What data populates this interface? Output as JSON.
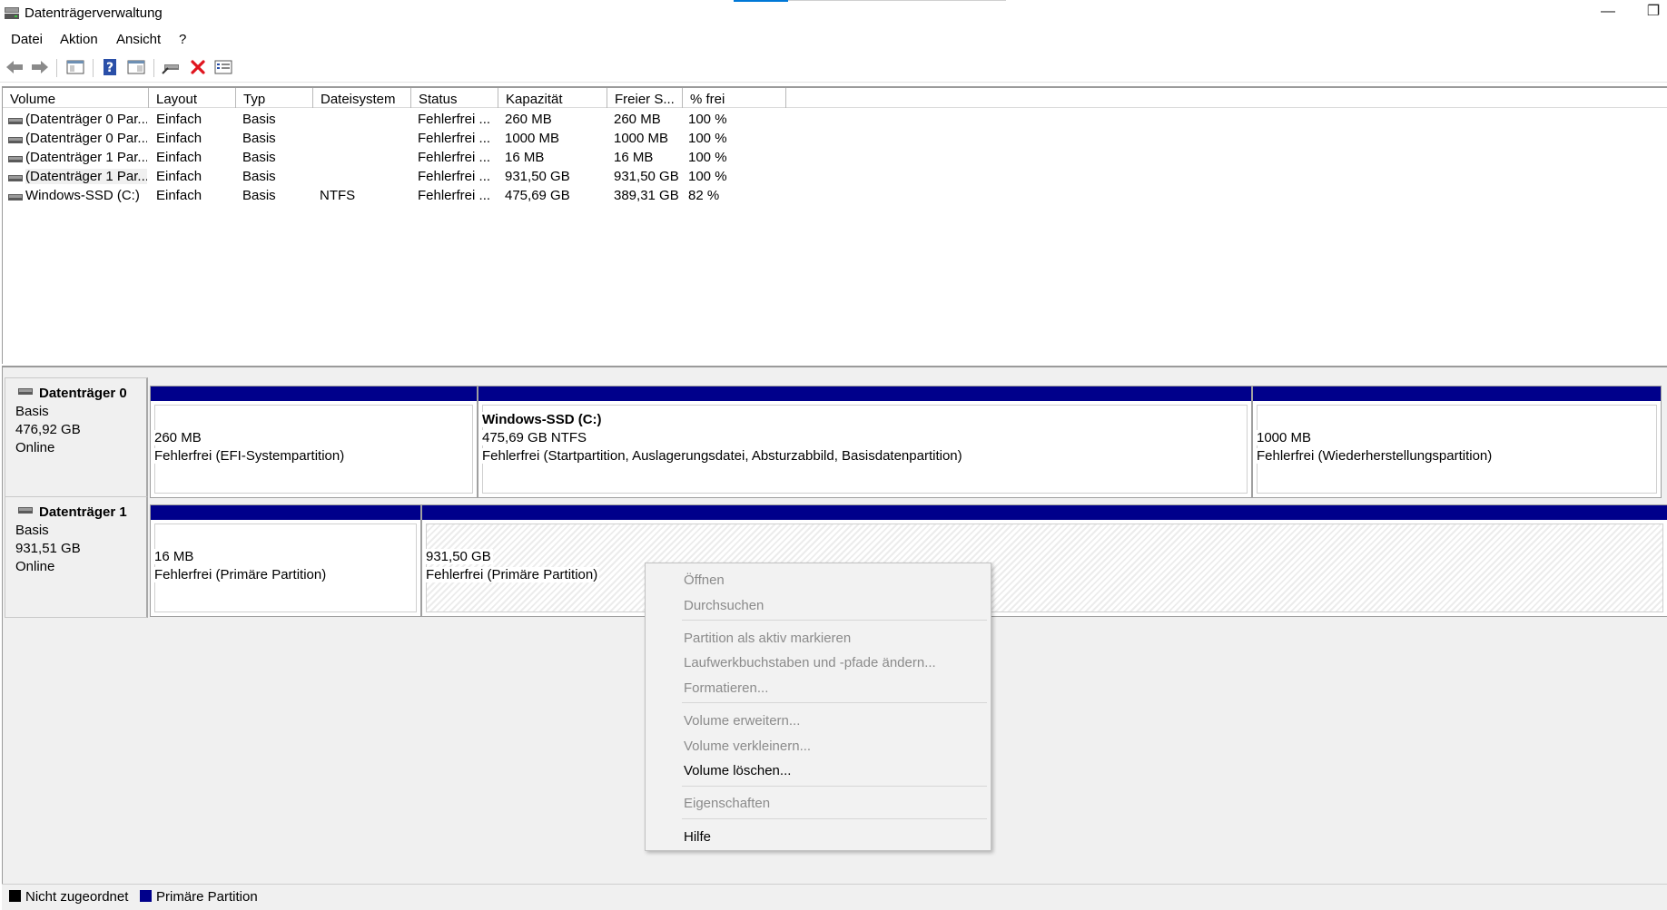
{
  "window": {
    "title": "Datenträgerverwaltung",
    "minimize_glyph": "—",
    "restore_glyph": "❐"
  },
  "menu": [
    "Datei",
    "Aktion",
    "Ansicht",
    "?"
  ],
  "toolbar": {
    "icons": [
      "back-arrow-icon",
      "forward-arrow-icon",
      "console-tree-icon",
      "help-icon",
      "show-pane-icon",
      "connect-disk-icon",
      "delete-icon",
      "properties-icon"
    ]
  },
  "volume_list": {
    "columns": [
      "Volume",
      "Layout",
      "Typ",
      "Dateisystem",
      "Status",
      "Kapazität",
      "Freier S...",
      "% frei"
    ],
    "rows": [
      [
        "(Datenträger 0 Par...",
        "Einfach",
        "Basis",
        "",
        "Fehlerfrei ...",
        "260 MB",
        "260 MB",
        "100 %"
      ],
      [
        "(Datenträger 0 Par...",
        "Einfach",
        "Basis",
        "",
        "Fehlerfrei ...",
        "1000 MB",
        "1000 MB",
        "100 %"
      ],
      [
        "(Datenträger 1 Par...",
        "Einfach",
        "Basis",
        "",
        "Fehlerfrei ...",
        "16 MB",
        "16 MB",
        "100 %"
      ],
      [
        "(Datenträger 1 Par...",
        "Einfach",
        "Basis",
        "",
        "Fehlerfrei ...",
        "931,50 GB",
        "931,50 GB",
        "100 %"
      ],
      [
        "Windows-SSD (C:)",
        "Einfach",
        "Basis",
        "NTFS",
        "Fehlerfrei ...",
        "475,69 GB",
        "389,31 GB",
        "82 %"
      ]
    ]
  },
  "disks": [
    {
      "name": "Datenträger 0",
      "type": "Basis",
      "size": "476,92 GB",
      "state": "Online",
      "partitions": [
        {
          "title": "",
          "size": "260 MB",
          "status": "Fehlerfrei (EFI-Systempartition)"
        },
        {
          "title": "Windows-SSD  (C:)",
          "size": "475,69 GB NTFS",
          "status": "Fehlerfrei (Startpartition, Auslagerungsdatei, Absturzabbild, Basisdatenpartition)"
        },
        {
          "title": "",
          "size": "1000 MB",
          "status": "Fehlerfrei (Wiederherstellungspartition)"
        }
      ]
    },
    {
      "name": "Datenträger 1",
      "type": "Basis",
      "size": "931,51 GB",
      "state": "Online",
      "partitions": [
        {
          "title": "",
          "size": "16 MB",
          "status": "Fehlerfrei (Primäre Partition)"
        },
        {
          "title": "",
          "size": "931,50 GB",
          "status": "Fehlerfrei (Primäre Partition)",
          "selected": true
        }
      ]
    }
  ],
  "context_menu": {
    "items": [
      {
        "label": "Öffnen",
        "enabled": false
      },
      {
        "label": "Durchsuchen",
        "enabled": false
      },
      {
        "label": "Partition als aktiv markieren",
        "enabled": false
      },
      {
        "label": "Laufwerkbuchstaben und -pfade ändern...",
        "enabled": false
      },
      {
        "label": "Formatieren...",
        "enabled": false
      },
      {
        "label": "Volume erweitern...",
        "enabled": false
      },
      {
        "label": "Volume verkleinern...",
        "enabled": false
      },
      {
        "label": "Volume löschen...",
        "enabled": true
      },
      {
        "label": "Eigenschaften",
        "enabled": false
      },
      {
        "label": "Hilfe",
        "enabled": true
      }
    ]
  },
  "legend": {
    "items": [
      {
        "label": "Nicht zugeordnet",
        "color": "#000000"
      },
      {
        "label": "Primäre Partition",
        "color": "#00008b"
      }
    ]
  }
}
